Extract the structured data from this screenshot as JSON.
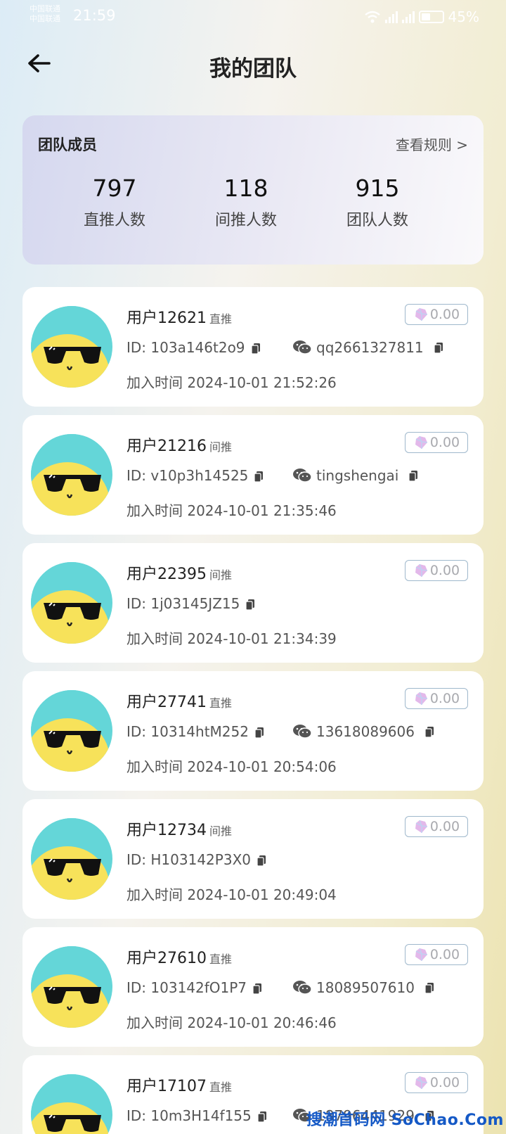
{
  "status_bar": {
    "carrier1": "中国联通",
    "carrier2": "中国联通",
    "time": "21:59",
    "battery": "45%",
    "battery_level": 0.45
  },
  "header": {
    "title": "我的团队"
  },
  "summary": {
    "label": "团队成员",
    "rules_link": "查看规则 >",
    "stats": [
      {
        "value": "797",
        "label": "直推人数"
      },
      {
        "value": "118",
        "label": "间推人数"
      },
      {
        "value": "915",
        "label": "团队人数"
      }
    ]
  },
  "members": [
    {
      "name": "用户12621",
      "tag": "直推",
      "balance": "0.00",
      "id": "ID: 103a146t2o9",
      "wechat": "qq2661327811",
      "joined": "加入时间 2024-10-01 21:52:26"
    },
    {
      "name": "用户21216",
      "tag": "间推",
      "balance": "0.00",
      "id": "ID: v10p3h14525",
      "wechat": "tingshengai",
      "joined": "加入时间 2024-10-01 21:35:46"
    },
    {
      "name": "用户22395",
      "tag": "间推",
      "balance": "0.00",
      "id": "ID: 1j03145JZ15",
      "wechat": "",
      "joined": "加入时间 2024-10-01 21:34:39"
    },
    {
      "name": "用户27741",
      "tag": "直推",
      "balance": "0.00",
      "id": "ID: 10314htM252",
      "wechat": "13618089606",
      "joined": "加入时间 2024-10-01 20:54:06"
    },
    {
      "name": "用户12734",
      "tag": "间推",
      "balance": "0.00",
      "id": "ID: H103142P3X0",
      "wechat": "",
      "joined": "加入时间 2024-10-01 20:49:04"
    },
    {
      "name": "用户27610",
      "tag": "直推",
      "balance": "0.00",
      "id": "ID: 103142fO1P7",
      "wechat": "18089507610",
      "joined": "加入时间 2024-10-01 20:46:46"
    },
    {
      "name": "用户17107",
      "tag": "直推",
      "balance": "0.00",
      "id": "ID: 10m3H14f155",
      "wechat": "18796441929",
      "joined": ""
    }
  ],
  "watermark": "搜潮首码网 SoChao.Com",
  "colors": {
    "avatar_bg": "#64d6d8",
    "avatar_face": "#f7e25a",
    "balance_border": "#9fb8cc",
    "watermark": "#1559c6"
  }
}
